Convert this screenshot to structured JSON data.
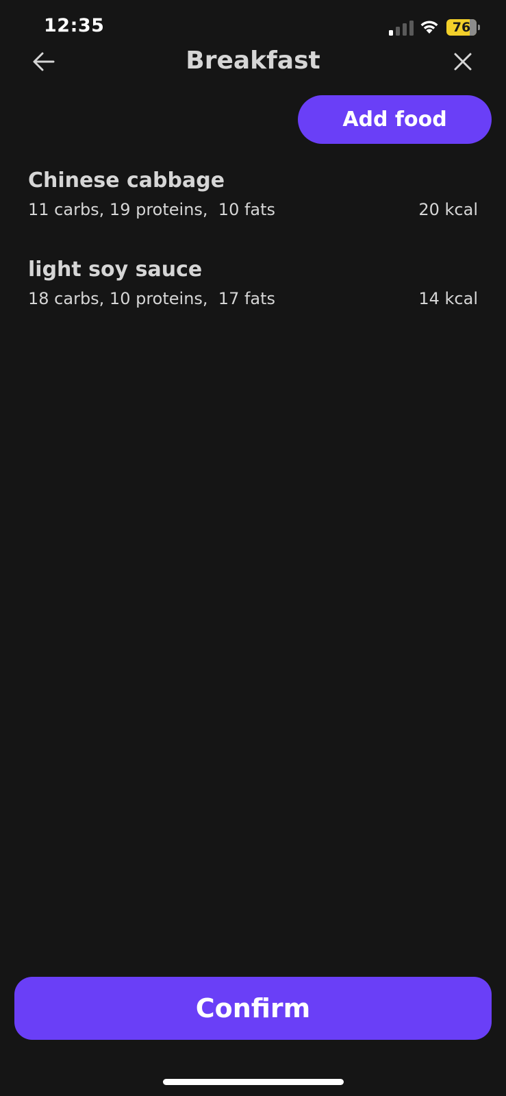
{
  "status_bar": {
    "time": "12:35",
    "battery_level": "76",
    "icons": [
      "signal-icon",
      "wifi-icon",
      "battery-icon"
    ],
    "battery_color": "#f2cf2a"
  },
  "header": {
    "title": "Breakfast",
    "back_icon": "arrow-left-icon",
    "close_icon": "close-icon"
  },
  "actions": {
    "add_food_label": "Add food",
    "confirm_label": "Confirm"
  },
  "foods": [
    {
      "name": "Chinese cabbage",
      "macros": "11 carbs, 19 proteins,  10 fats",
      "kcal": "20 kcal"
    },
    {
      "name": "light soy sauce",
      "macros": "18 carbs, 10 proteins,  17 fats",
      "kcal": "14 kcal"
    }
  ],
  "colors": {
    "background": "#151515",
    "accent": "#6a3ff7",
    "text": "#d6d6d6"
  }
}
